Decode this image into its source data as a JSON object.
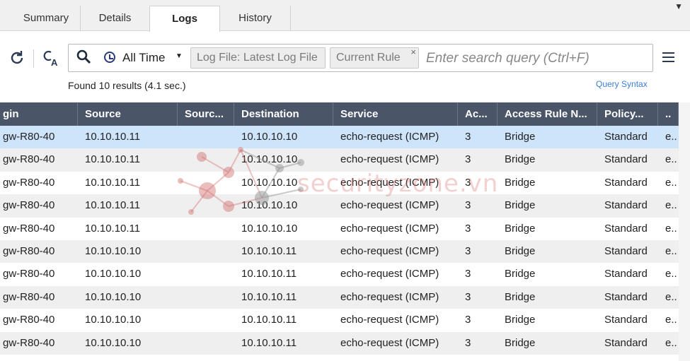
{
  "tabs": [
    {
      "label": "Summary",
      "active": false
    },
    {
      "label": "Details",
      "active": false
    },
    {
      "label": "Logs",
      "active": true
    },
    {
      "label": "History",
      "active": false
    }
  ],
  "toolbar": {
    "refresh_icon": "refresh-icon",
    "case_icon": "match-case-icon",
    "time_filter": "All Time",
    "chips": [
      {
        "label": "Log File: Latest Log File",
        "closable": false
      },
      {
        "label": "Current Rule",
        "closable": true,
        "close": "×"
      }
    ],
    "search_placeholder": "Enter search query (Ctrl+F)",
    "menu_icon": "hamburger-menu-icon"
  },
  "results": {
    "found_text": "Found 10 results (4.1 sec.)",
    "query_syntax": "Query Syntax"
  },
  "table": {
    "columns": [
      "gin",
      "Source",
      "Sourc...",
      "Destination",
      "Service",
      "Ac...",
      "Access Rule N...",
      "Policy...",
      ".."
    ],
    "rows": [
      [
        "gw-R80-40",
        "10.10.10.11",
        "",
        "10.10.10.10",
        "echo-request (ICMP)",
        "3",
        "Bridge",
        "Standard",
        "e.."
      ],
      [
        "gw-R80-40",
        "10.10.10.11",
        "",
        "10.10.10.10",
        "echo-request (ICMP)",
        "3",
        "Bridge",
        "Standard",
        "e.."
      ],
      [
        "gw-R80-40",
        "10.10.10.11",
        "",
        "10.10.10.10",
        "echo-request (ICMP)",
        "3",
        "Bridge",
        "Standard",
        "e.."
      ],
      [
        "gw-R80-40",
        "10.10.10.11",
        "",
        "10.10.10.10",
        "echo-request (ICMP)",
        "3",
        "Bridge",
        "Standard",
        "e.."
      ],
      [
        "gw-R80-40",
        "10.10.10.11",
        "",
        "10.10.10.10",
        "echo-request (ICMP)",
        "3",
        "Bridge",
        "Standard",
        "e.."
      ],
      [
        "gw-R80-40",
        "10.10.10.10",
        "",
        "10.10.10.11",
        "echo-request (ICMP)",
        "3",
        "Bridge",
        "Standard",
        "e.."
      ],
      [
        "gw-R80-40",
        "10.10.10.10",
        "",
        "10.10.10.11",
        "echo-request (ICMP)",
        "3",
        "Bridge",
        "Standard",
        "e.."
      ],
      [
        "gw-R80-40",
        "10.10.10.10",
        "",
        "10.10.10.11",
        "echo-request (ICMP)",
        "3",
        "Bridge",
        "Standard",
        "e.."
      ],
      [
        "gw-R80-40",
        "10.10.10.10",
        "",
        "10.10.10.11",
        "echo-request (ICMP)",
        "3",
        "Bridge",
        "Standard",
        "e.."
      ],
      [
        "gw-R80-40",
        "10.10.10.10",
        "",
        "10.10.10.11",
        "echo-request (ICMP)",
        "3",
        "Bridge",
        "Standard",
        "e.."
      ]
    ],
    "selected_row": 0
  },
  "watermark": {
    "text": "securityzone.vn"
  },
  "colors": {
    "header_bg": "#4a5568",
    "selected_row": "#cde4fb",
    "link": "#3b7fd6"
  }
}
